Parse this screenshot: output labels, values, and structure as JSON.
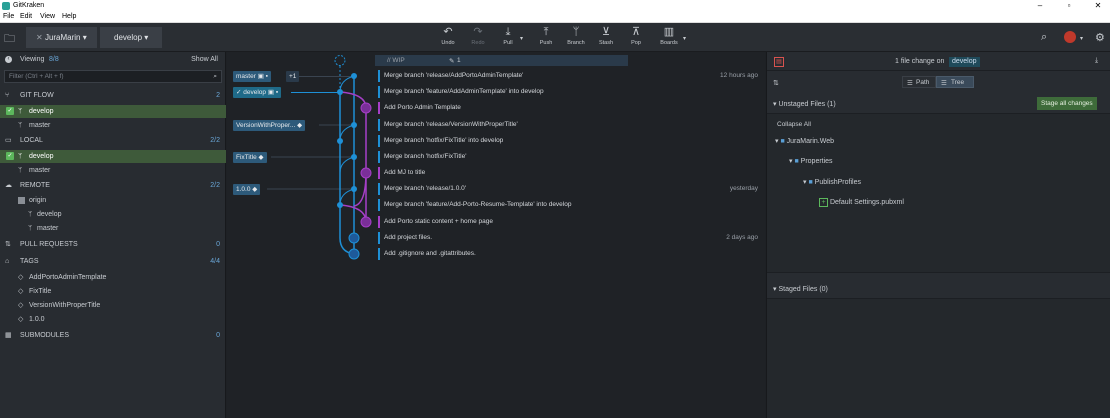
{
  "window": {
    "title": "GitKraken"
  },
  "menu": {
    "file": "File",
    "edit": "Edit",
    "view": "View",
    "help": "Help"
  },
  "toolbar": {
    "repo": "JuraMarin",
    "branch": "develop",
    "undo": "Undo",
    "redo": "Redo",
    "pull": "Pull",
    "push": "Push",
    "branch_label": "Branch",
    "stash": "Stash",
    "pop": "Pop",
    "boards": "Boards"
  },
  "left": {
    "viewing": "Viewing",
    "viewing_count": "8/8",
    "show_all": "Show All",
    "filter_placeholder": "Filter (Ctrl + Alt + f)",
    "gitflow": {
      "label": "GIT FLOW",
      "count": "2",
      "items": [
        "develop",
        "master"
      ]
    },
    "local": {
      "label": "LOCAL",
      "count": "2/2",
      "items": [
        "develop",
        "master"
      ]
    },
    "remote": {
      "label": "REMOTE",
      "count": "2/2",
      "origin": "origin",
      "items": [
        "develop",
        "master"
      ]
    },
    "pull_requests": {
      "label": "PULL REQUESTS",
      "count": "0"
    },
    "tags": {
      "label": "TAGS",
      "count": "4/4",
      "items": [
        "AddPortoAdminTemplate",
        "FixTitle",
        "VersionWithProperTitle",
        "1.0.0"
      ]
    },
    "submodules": {
      "label": "SUBMODULES",
      "count": "0"
    }
  },
  "graph": {
    "wip": "// WIP",
    "wip_count": "1",
    "refs": {
      "master": "master",
      "master_plus": "+1",
      "develop": "develop",
      "version": "VersionWithProper...",
      "fixtitle": "FixTitle",
      "v100": "1.0.0"
    },
    "commits": [
      {
        "message": "Merge branch 'release/AddPortoAdminTemplate'",
        "time": "12 hours ago"
      },
      {
        "message": "Merge branch 'feature/AddAdminTemplate' into develop",
        "time": ""
      },
      {
        "message": "Add Porto Admin Template",
        "time": ""
      },
      {
        "message": "Merge branch 'release/VersionWithProperTitle'",
        "time": ""
      },
      {
        "message": "Merge branch 'hotfix/FixTitle' into develop",
        "time": ""
      },
      {
        "message": "Merge branch 'hotfix/FixTitle'",
        "time": ""
      },
      {
        "message": "Add MJ to title",
        "time": ""
      },
      {
        "message": "Merge branch 'release/1.0.0'",
        "time": "yesterday"
      },
      {
        "message": "Merge branch 'feature/Add-Porto-Resume-Template' into develop",
        "time": ""
      },
      {
        "message": "Add Porto static content + home page",
        "time": ""
      },
      {
        "message": "Add project files.",
        "time": "2 days ago"
      },
      {
        "message": "Add .gitignore and .gitattributes.",
        "time": ""
      }
    ]
  },
  "right": {
    "summary_prefix": "1 file change on",
    "summary_branch": "develop",
    "path": "Path",
    "tree": "Tree",
    "unstaged": "Unstaged Files (1)",
    "stage_all": "Stage all changes",
    "collapse_all": "Collapse All",
    "tree_items": [
      "JuraMarin.Web",
      "Properties",
      "PublishProfiles",
      "Default Settings.pubxml"
    ],
    "staged": "Staged Files (0)"
  },
  "colors": {
    "accent": "#1f8ac0",
    "lane_blue": "#1e90d6",
    "lane_purple": "#a63fc8",
    "green": "#5cb85c"
  }
}
